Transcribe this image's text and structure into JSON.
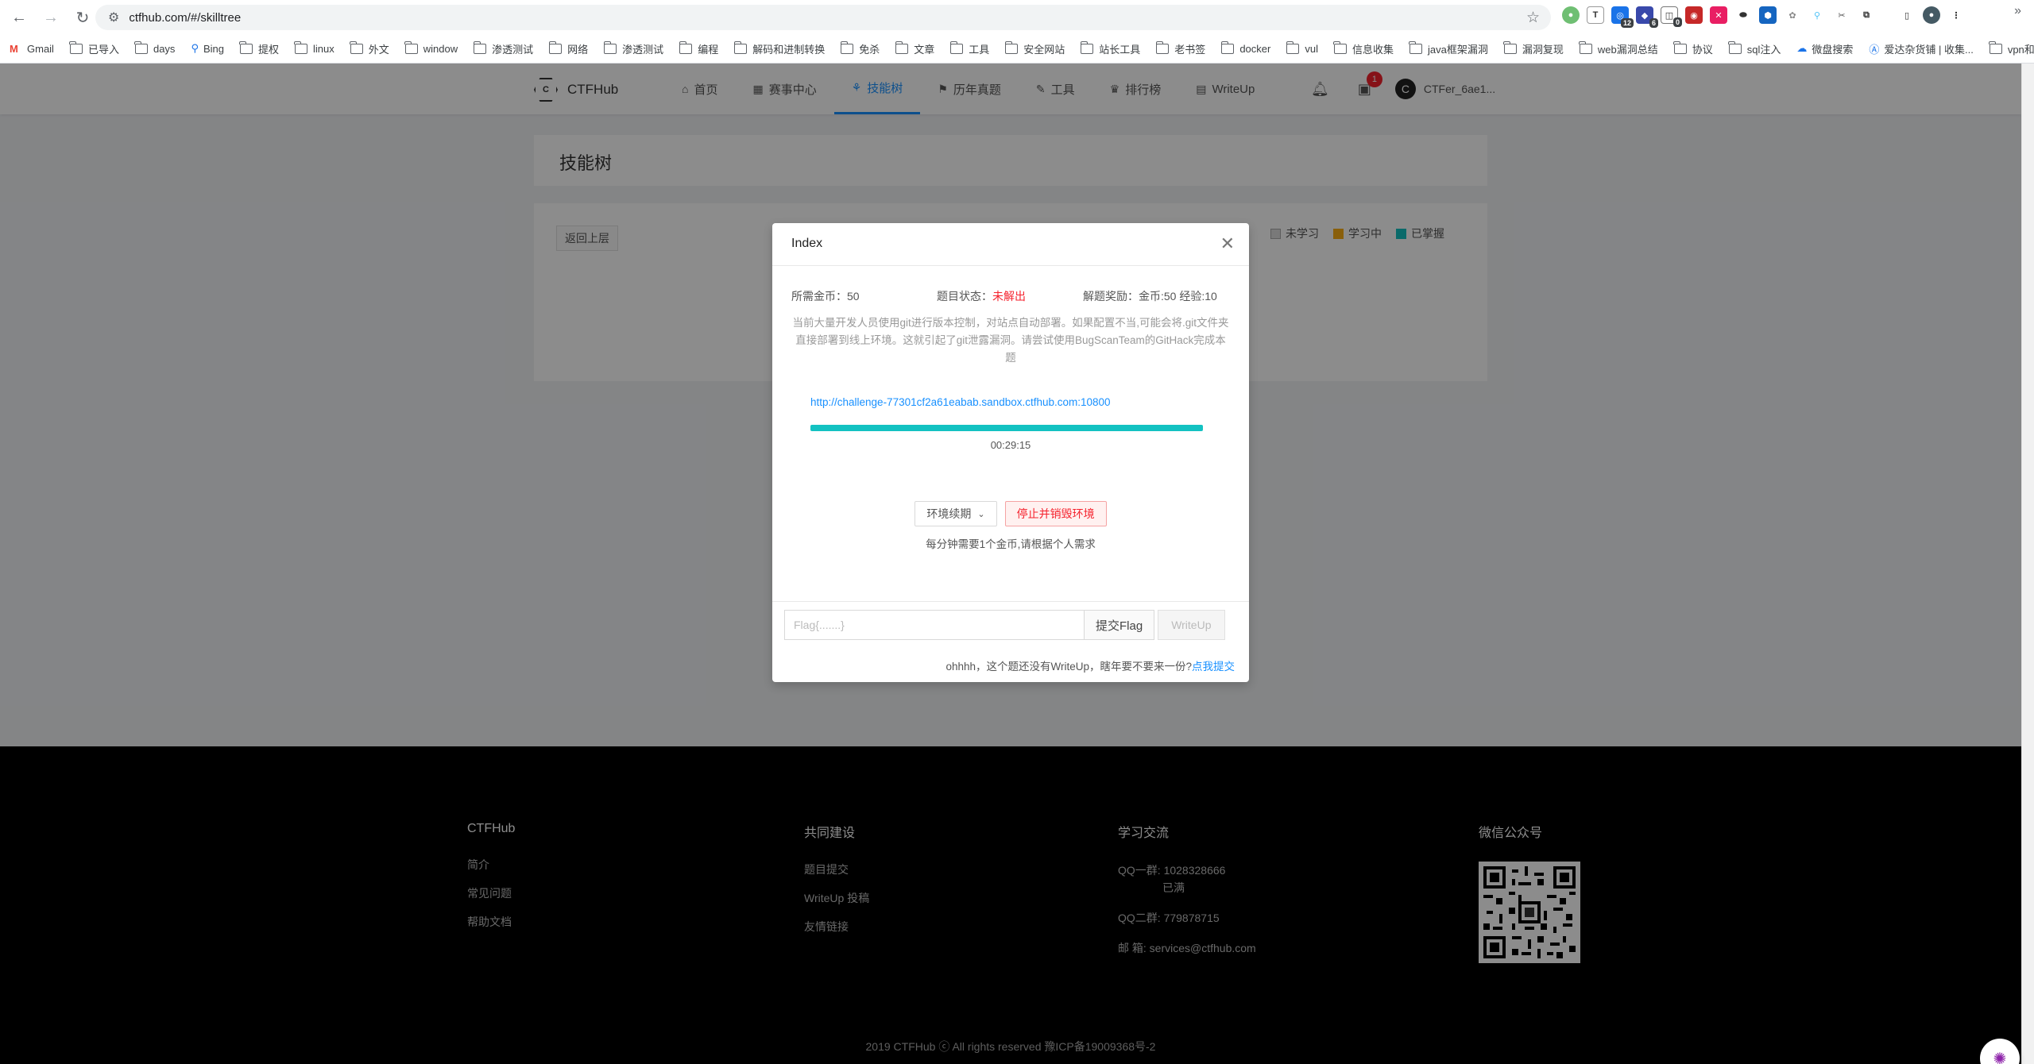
{
  "browser": {
    "url": "ctfhub.com/#/skilltree",
    "bookmarks": [
      "Gmail",
      "已导入",
      "days",
      "Bing",
      "提权",
      "linux",
      "外文",
      "window",
      "渗透测试",
      "网络",
      "渗透测试",
      "编程",
      "解码和进制转换",
      "免杀",
      "文章",
      "工具",
      "安全网站",
      "站长工具",
      "老书签",
      "docker",
      "vul",
      "信息收集",
      "java框架漏洞",
      "漏洞复现",
      "web漏洞总结",
      "协议",
      "sql注入",
      "微盘搜索",
      "爱达杂货铺 | 收集...",
      "vpn和vps"
    ],
    "ext_badges": {
      "e3": "12",
      "e4": "6",
      "e5": "0"
    }
  },
  "site": {
    "logo": "CTFHub",
    "nav": [
      "首页",
      "赛事中心",
      "技能树",
      "历年真题",
      "工具",
      "排行榜",
      "WriteUp"
    ],
    "notif_count": "1",
    "avatar_letter": "C",
    "username": "CTFer_6ae1..."
  },
  "title": "技能树",
  "back_button": "返回上层",
  "legend": [
    "未学习",
    "学习中",
    "已掌握"
  ],
  "colors": {
    "not_learned": "#dcdcdc",
    "learning": "#faad14",
    "mastered": "#13c2c2",
    "accent": "#1890ff",
    "danger": "#f5222d"
  },
  "modal": {
    "title": "Index",
    "coins_label": "所需金币：",
    "coins_value": "50",
    "status_label": "题目状态：",
    "status_value": "未解出",
    "reward": "解题奖励：金币:50 经验:10",
    "description": "当前大量开发人员使用git进行版本控制，对站点自动部署。如果配置不当,可能会将.git文件夹直接部署到线上环境。这就引起了git泄露漏洞。请尝试使用BugScanTeam的GitHack完成本题",
    "link": "http://challenge-77301cf2a61eabab.sandbox.ctfhub.com:10800",
    "progress": 1.0,
    "timer": "00:29:15",
    "renew_label": "环境续期",
    "stop_label": "停止并销毁环境",
    "note": "每分钟需要1个金币,请根据个人需求",
    "flag_placeholder": "Flag{.......}",
    "submit_label": "提交Flag",
    "writeup_label": "WriteUp",
    "hint_text": "ohhhh，这个题还没有WriteUp，瞎年要不要来一份?",
    "hint_link": "点我提交"
  },
  "footer": {
    "col1": {
      "title": "CTFHub",
      "links": [
        "简介",
        "常见问题",
        "帮助文档"
      ]
    },
    "col2": {
      "title": "共同建设",
      "links": [
        "题目提交",
        "WriteUp 投稿",
        "友情链接"
      ]
    },
    "col3": {
      "title": "学习交流",
      "qq1_label": "QQ一群:",
      "qq1_value": "1028328666",
      "qq1_note": "已满",
      "qq2_label": "QQ二群:",
      "qq2_value": "779878715",
      "mail_label": "邮  箱:",
      "mail_value": "services@ctfhub.com"
    },
    "col4": {
      "title": "微信公众号"
    },
    "copyright": "2019 CTFHub ⓒ  All rights reserved    豫ICP备19009368号-2"
  }
}
